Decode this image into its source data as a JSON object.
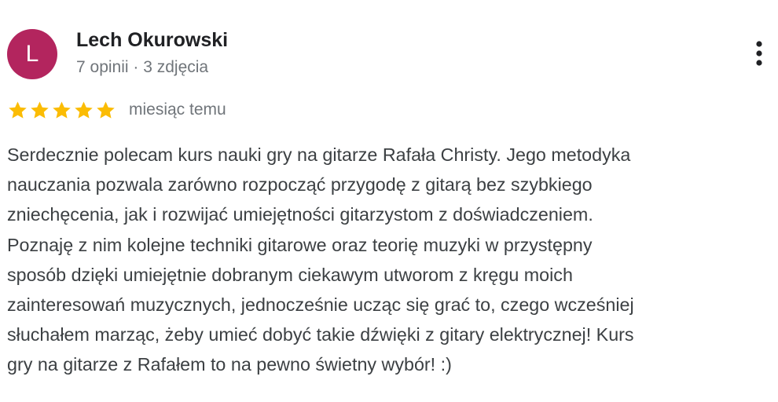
{
  "reviewer": {
    "avatar_letter": "L",
    "avatar_color": "#b3255e",
    "name": "Lech Okurowski",
    "meta": "7 opinii · 3 zdjęcia"
  },
  "menu": {
    "icon": "more-vert-icon"
  },
  "rating": {
    "stars": 5,
    "max_stars": 5,
    "star_color": "#fbbc04",
    "time_ago": "miesiąc temu"
  },
  "review": {
    "lines": [
      "Serdecznie polecam kurs nauki gry na gitarze Rafała Christy. Jego metodyka",
      "nauczania pozwala zarówno rozpocząć przygodę z gitarą bez szybkiego",
      "zniechęcenia, jak i rozwijać umiejętności gitarzystom z doświadczeniem.",
      "Poznaję z nim kolejne techniki gitarowe oraz teorię muzyki w przystępny",
      "sposób dzięki umiejętnie dobranym ciekawym utworom z kręgu moich",
      "zainteresowań muzycznych, jednocześnie ucząc się grać to, czego wcześniej",
      "słuchałem marząc, żeby umieć dobyć takie dźwięki z gitary elektrycznej! Kurs",
      "gry na gitarze z Rafałem to na pewno świetny wybór! :)"
    ]
  }
}
